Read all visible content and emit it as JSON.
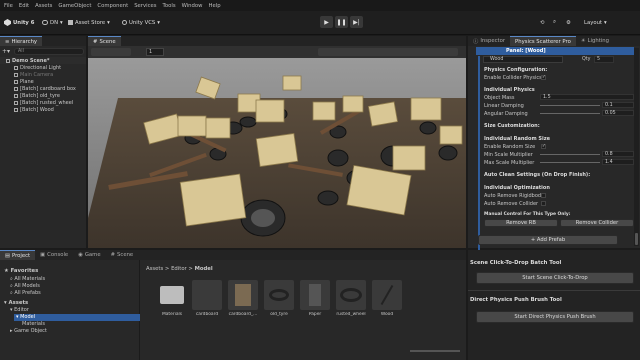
{
  "menu": [
    "File",
    "Edit",
    "Assets",
    "GameObject",
    "Component",
    "Services",
    "Tools",
    "Window",
    "Help"
  ],
  "toolbar": {
    "unity_label": "Unity 6",
    "account_label": "DN",
    "store_label": "Asset Store",
    "vcs_label": "Unity VCS",
    "layout_label": "Layout"
  },
  "hierarchy": {
    "tab": "Hierarchy",
    "search_placeholder": "All",
    "rows": [
      {
        "label": "Demo Scene*",
        "indent": 0
      },
      {
        "label": "Directional Light",
        "indent": 1
      },
      {
        "label": "Main Camera",
        "indent": 1
      },
      {
        "label": "Plane",
        "indent": 1
      },
      {
        "label": "[Batch] cardboard box",
        "indent": 1
      },
      {
        "label": "[Batch] old_tyre",
        "indent": 1
      },
      {
        "label": "[Batch] rusted_wheel",
        "indent": 1
      },
      {
        "label": "[Batch] Wood",
        "indent": 1
      }
    ]
  },
  "scene": {
    "tab": "Scene",
    "zoom_value": "1"
  },
  "inspector": {
    "tabs": [
      "Inspector",
      "Physics Scatterer Pro",
      "Lighting"
    ],
    "panel_title": "Panel: [Wood]",
    "object_field": "Wood",
    "qty_label": "Qty",
    "qty_value": "5",
    "physics_config": "Physics Configuration:",
    "enable_collider_physics": "Enable Collider Physics",
    "individual_physics": "Individual Physics",
    "object_mass": "Object Mass",
    "object_mass_value": "1.5",
    "linear_damping": "Linear Damping",
    "linear_damping_value": "0.1",
    "angular_damping": "Angular Damping",
    "angular_damping_value": "0.05",
    "size_customization": "Size Customization:",
    "individual_random_size": "Individual Random Size",
    "enable_random_size": "Enable Random Size",
    "min_scale": "Min Scale Multiplier",
    "min_scale_value": "0.8",
    "max_scale": "Max Scale Multiplier",
    "max_scale_value": "1.4",
    "auto_clean": "Auto Clean Settings (On Drop Finish):",
    "individual_optimization": "Individual Optimization",
    "auto_remove_rigidbody": "Auto Remove Rigidbody",
    "auto_remove_collider": "Auto Remove Collider",
    "manual_control": "Manual Control For This Type Only:",
    "remove_rb": "Remove RB",
    "remove_collider": "Remove Collider",
    "add_prefab": "+ Add Prefab"
  },
  "tools": {
    "click_to_drop_title": "Scene Click-To-Drop Batch Tool",
    "click_to_drop_button": "Start Scene Click-To-Drop",
    "push_brush_title": "Direct Physics Push Brush Tool",
    "push_brush_button": "Start Direct Physics Push Brush"
  },
  "project": {
    "tabs": [
      "Project",
      "Console",
      "Game",
      "Scene"
    ],
    "favorites": "Favorites",
    "fav_items": [
      "All Materials",
      "All Models",
      "All Prefabs"
    ],
    "assets_root": "Assets",
    "tree": [
      "Editor",
      "Model",
      "Materials",
      "Game Object"
    ],
    "breadcrumb": [
      "Assets",
      "Editor",
      "Model"
    ],
    "assets": [
      "Materials",
      "cardboard",
      "cardboard_...",
      "old_tyre",
      "Paper",
      "rusted_wheel",
      "Wood"
    ]
  },
  "colors": {
    "accent": "#2f5d9e",
    "panel": "#282828",
    "viewport_sky": "#8a8a8a"
  }
}
